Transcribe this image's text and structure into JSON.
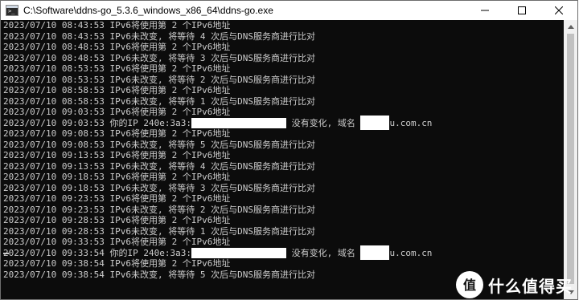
{
  "window": {
    "title": "C:\\Software\\ddns-go_5.3.6_windows_x86_64\\ddns-go.exe",
    "app_icon": "console-icon",
    "prompt_glyph": ">_",
    "controls": [
      "minimize-icon",
      "maximize-icon",
      "close-icon"
    ]
  },
  "console": {
    "lines": [
      {
        "ts": "2023/07/10 08:43:53",
        "msg": "IPv6将使用第 2 个IPv6地址"
      },
      {
        "ts": "2023/07/10 08:43:53",
        "msg": "IPv6未改变, 将等待 4 次后与DNS服务商进行比对"
      },
      {
        "ts": "2023/07/10 08:48:53",
        "msg": "IPv6将使用第 2 个IPv6地址"
      },
      {
        "ts": "2023/07/10 08:48:53",
        "msg": "IPv6未改变, 将等待 3 次后与DNS服务商进行比对"
      },
      {
        "ts": "2023/07/10 08:53:53",
        "msg": "IPv6将使用第 2 个IPv6地址"
      },
      {
        "ts": "2023/07/10 08:53:53",
        "msg": "IPv6未改变, 将等待 2 次后与DNS服务商进行比对"
      },
      {
        "ts": "2023/07/10 08:58:53",
        "msg": "IPv6将使用第 2 个IPv6地址"
      },
      {
        "ts": "2023/07/10 08:58:53",
        "msg": "IPv6未改变, 将等待 1 次后与DNS服务商进行比对"
      },
      {
        "ts": "2023/07/10 09:03:53",
        "msg": "IPv6将使用第 2 个IPv6地址"
      },
      {
        "ts": "2023/07/10 09:03:53",
        "msg": "你的IP 240e:3a3:",
        "masked": true,
        "msg2": " 没有变化, 域名 ",
        "tail": "u.com.cn"
      },
      {
        "ts": "2023/07/10 09:08:53",
        "msg": "IPv6将使用第 2 个IPv6地址"
      },
      {
        "ts": "2023/07/10 09:08:53",
        "msg": "IPv6未改变, 将等待 5 次后与DNS服务商进行比对"
      },
      {
        "ts": "2023/07/10 09:13:53",
        "msg": "IPv6将使用第 2 个IPv6地址"
      },
      {
        "ts": "2023/07/10 09:13:53",
        "msg": "IPv6未改变, 将等待 4 次后与DNS服务商进行比对"
      },
      {
        "ts": "2023/07/10 09:18:53",
        "msg": "IPv6将使用第 2 个IPv6地址"
      },
      {
        "ts": "2023/07/10 09:18:53",
        "msg": "IPv6未改变, 将等待 3 次后与DNS服务商进行比对"
      },
      {
        "ts": "2023/07/10 09:23:53",
        "msg": "IPv6将使用第 2 个IPv6地址"
      },
      {
        "ts": "2023/07/10 09:23:53",
        "msg": "IPv6未改变, 将等待 2 次后与DNS服务商进行比对"
      },
      {
        "ts": "2023/07/10 09:28:53",
        "msg": "IPv6将使用第 2 个IPv6地址"
      },
      {
        "ts": "2023/07/10 09:28:53",
        "msg": "IPv6未改变, 将等待 1 次后与DNS服务商进行比对"
      },
      {
        "ts": "2023/07/10 09:33:53",
        "msg": "IPv6将使用第 2 个IPv6地址"
      },
      {
        "ts": "2023/07/10 09:33:54",
        "msg": "你的IP 240e:3a3:",
        "masked": true,
        "msg2": " 没有变化, 域名 ",
        "tail": "u.com.cn"
      },
      {
        "ts": "2023/07/10 09:38:54",
        "msg": "IPv6将使用第 2 个IPv6地址"
      },
      {
        "ts": "2023/07/10 09:38:54",
        "msg": "IPv6未改变, 将等待 5 次后与DNS服务商进行比对"
      }
    ]
  },
  "watermark": {
    "logo_glyph": "值",
    "text": "什么值得买"
  },
  "colors": {
    "console_bg": "#0c0c0c",
    "console_text": "#cccccc",
    "redaction": "#ffffff"
  }
}
